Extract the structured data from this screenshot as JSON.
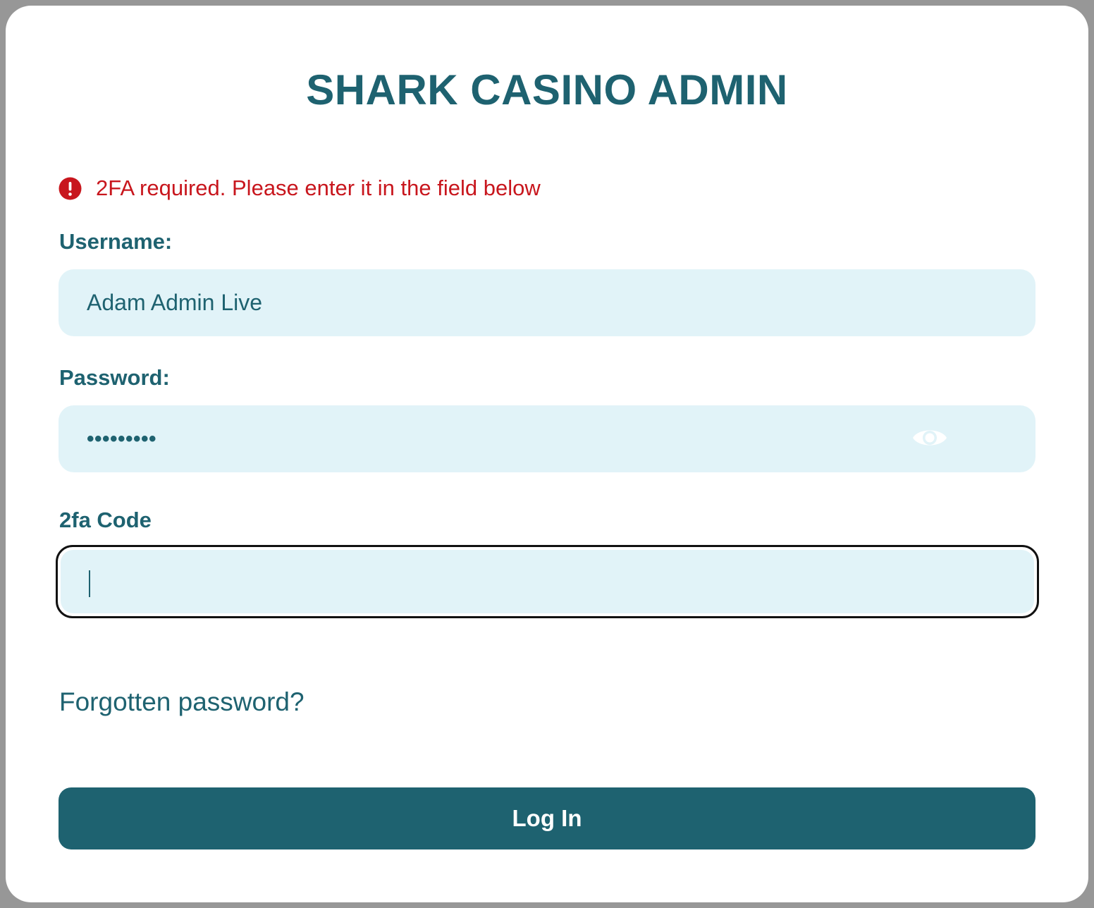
{
  "app": {
    "title": "SHARK CASINO ADMIN"
  },
  "alert": {
    "icon": "exclamation-circle-icon",
    "message": "2FA required. Please enter it in the field below",
    "color": "#c8161d"
  },
  "form": {
    "username": {
      "label": "Username:",
      "value": "Adam Admin Live"
    },
    "password": {
      "label": "Password:",
      "masked_value": "•••••••••",
      "toggle_icon": "eye-icon"
    },
    "twofa": {
      "label": "2fa Code",
      "value": ""
    },
    "forgot_link": "Forgotten password?",
    "submit_label": "Log In"
  },
  "colors": {
    "brand": "#1e6270",
    "field_background": "#e1f3f8",
    "error": "#c8161d",
    "page_background": "#979797"
  }
}
